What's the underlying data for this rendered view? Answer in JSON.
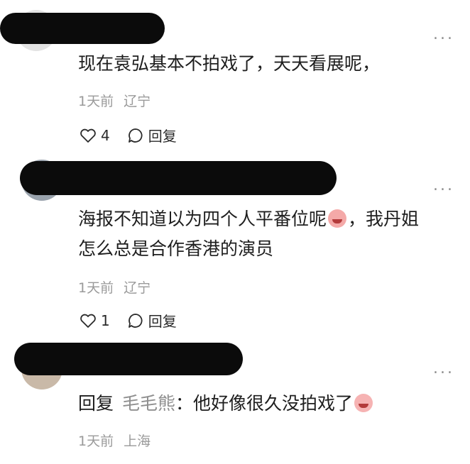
{
  "comments": [
    {
      "text": "现在袁弘基本不拍戏了，天天看展呢，",
      "time": "1天前",
      "location": "辽宁",
      "likes": "4",
      "reply_label": "回复",
      "more": "..."
    },
    {
      "text_line1": "海报不知道以为四个人平番位呢",
      "text_line1_after": "，我丹姐",
      "text_line2": "怎么总是合作香港的演员",
      "time": "1天前",
      "location": "辽宁",
      "likes": "1",
      "reply_label": "回复",
      "more": "..."
    },
    {
      "reply_prefix": "回复",
      "reply_target": "毛毛熊",
      "text": "：他好像很久没拍戏了",
      "time": "1天前",
      "location": "上海",
      "more": "..."
    }
  ],
  "colors": {
    "redaction": "#0b0b0b",
    "meta": "#9a9a9a",
    "text": "#1e1e1e"
  },
  "icons": [
    "heart-icon",
    "comment-bubble-icon",
    "more-icon",
    "crying-emoji-icon",
    "laughing-emoji-icon"
  ]
}
